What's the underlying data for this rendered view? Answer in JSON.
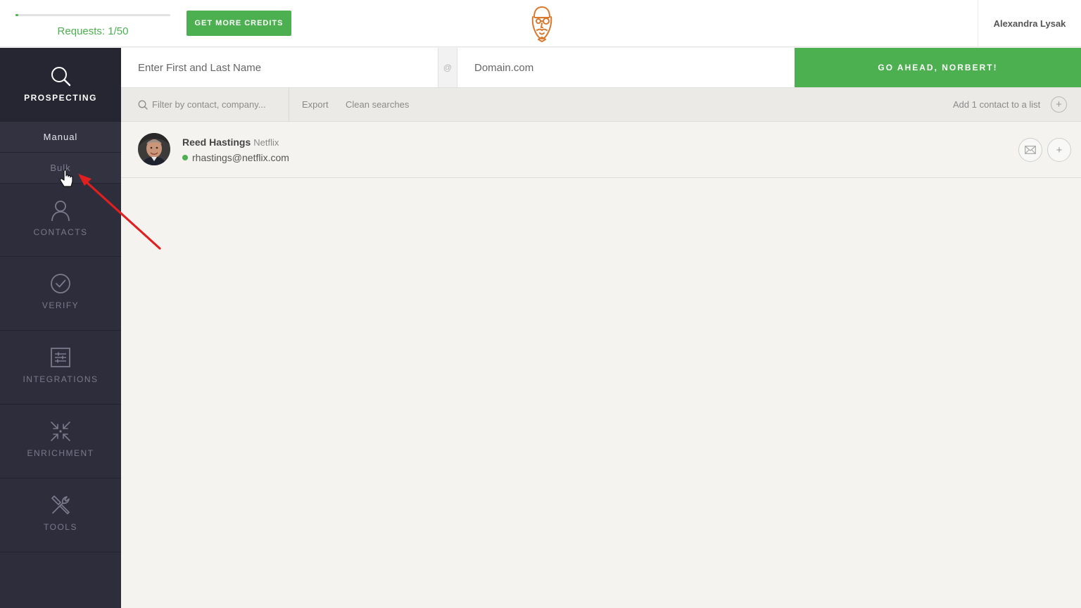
{
  "header": {
    "requests_label": "Requests: 1/50",
    "requests_fraction": 0.02,
    "get_credits_label": "GET MORE CREDITS",
    "user_name": "Alexandra Lysak"
  },
  "sidebar": {
    "prospecting": "PROSPECTING",
    "sub_items": [
      "Manual",
      "Bulk"
    ],
    "contacts": "CONTACTS",
    "verify": "VERIFY",
    "integrations": "INTEGRATIONS",
    "enrichment": "ENRICHMENT",
    "tools": "TOOLS"
  },
  "search": {
    "name_placeholder": "Enter First and Last Name",
    "at_symbol": "@",
    "domain_placeholder": "Domain.com",
    "go_label": "GO AHEAD, NORBERT!"
  },
  "toolbar": {
    "filter_placeholder": "Filter by contact, company...",
    "export": "Export",
    "clean": "Clean searches",
    "add_to_list": "Add 1 contact to a list",
    "add_symbol": "+"
  },
  "contact": {
    "name": "Reed Hastings",
    "company": "Netflix",
    "email": "rhastings@netflix.com",
    "add_symbol": "+"
  },
  "colors": {
    "accent": "#4caf50",
    "sidebar": "#2d2d3b",
    "annotation_arrow": "#e02020"
  }
}
